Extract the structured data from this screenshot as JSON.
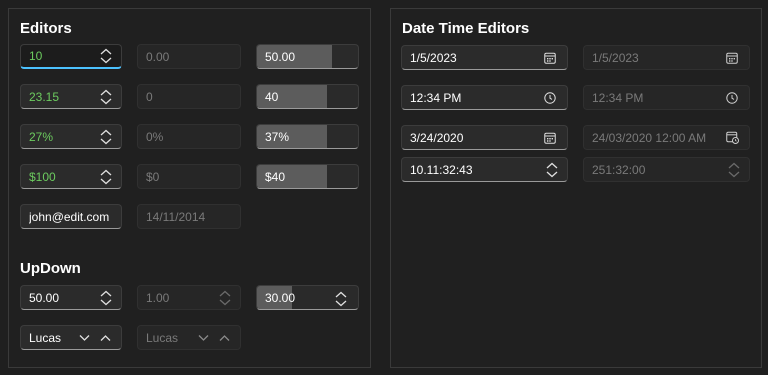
{
  "editors": {
    "title": "Editors",
    "numeric": [
      {
        "value": "10",
        "disabled_value": "0.00",
        "slider_value": "50.00",
        "slider_fill": 0.5
      },
      {
        "value": "23.15",
        "disabled_value": "0",
        "slider_value": "40",
        "slider_fill": 0.4
      },
      {
        "value": "27%",
        "disabled_value": "0%",
        "slider_value": "37%",
        "slider_fill": 0.37
      },
      {
        "value": "$100",
        "disabled_value": "$0",
        "slider_value": "$40",
        "slider_fill": 0.4
      }
    ],
    "mask": {
      "value": "john@edit.com",
      "disabled_value": "14/11/2014"
    }
  },
  "updown": {
    "title": "UpDown",
    "numeric": {
      "value": "50.00",
      "disabled_value": "1.00",
      "slider_value": "30.00",
      "slider_fill": 0.3
    },
    "domain": {
      "value": "Lucas",
      "disabled_value": "Lucas"
    }
  },
  "datetime": {
    "title": "Date Time Editors",
    "date": {
      "value": "1/5/2023",
      "disabled_value": "1/5/2023"
    },
    "time": {
      "value": "12:34 PM",
      "disabled_value": "12:34 PM"
    },
    "datetime": {
      "value": "3/24/2020",
      "disabled_value": "24/03/2020 12:00 AM"
    },
    "timespan": {
      "value": "10.11:32:43",
      "disabled_value": "251:32:00"
    }
  },
  "colors": {
    "accent": "#4cc2ff",
    "positive": "#6ccb5f"
  },
  "icons": [
    "chevron-up-icon",
    "chevron-down-icon",
    "calendar-icon",
    "clock-icon",
    "calendar-clock-icon"
  ]
}
